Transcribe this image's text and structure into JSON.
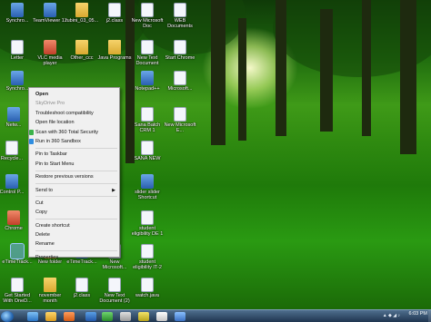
{
  "desktop": {
    "icons": {
      "synchro1": "Synchro...",
      "teamviewer": "TeamViewer 12",
      "rubini": "rubini_03_05...",
      "j2": "j2.class",
      "newdoc1": "New Microsoft Doc",
      "web": "WEB Documents",
      "letter": "Letter",
      "vlc": "VLC media player",
      "other": "Other_ccc",
      "javaprog": "Java Programs",
      "newtext": "New Text Document",
      "chrome": "Start Chrome",
      "synchro2": "Synchro...",
      "notepad": "Notepad++",
      "microsoft1": "Microsoft...",
      "netw": "Netw...",
      "sana": "Sana Batch CRM 1",
      "newexcel": "New Microsoft E...",
      "recycle": "Recycle...",
      "sananew": "SANA NEW",
      "control": "Control P...",
      "slider": "slider slider Shortcut",
      "chrome2": "Chrome",
      "student1": "student eligibility DE 1",
      "student2": "student eligibility IT-2",
      "selected": "eTimeTrack...",
      "newfolder": "New folder",
      "etimetrack": "eTimeTrack...",
      "newms": "New Microsoft...",
      "getstarted": "Get Started With OneD...",
      "november": "november month",
      "j2class": "j2.class",
      "newtext2": "New Text Document (2)",
      "watchjava": "watch.java"
    }
  },
  "context_menu": {
    "open": "Open",
    "skydrive": "SkyDrive Pro",
    "troubleshoot": "Troubleshoot compatibility",
    "open_file_location": "Open file location",
    "scan_360": "Scan with 360 Total Security",
    "run_sandbox": "Run in 360 Sandbox",
    "pin_taskbar": "Pin to Taskbar",
    "pin_start": "Pin to Start Menu",
    "restore": "Restore previous versions",
    "send_to": "Send to",
    "cut": "Cut",
    "copy": "Copy",
    "create_shortcut": "Create shortcut",
    "delete": "Delete",
    "rename": "Rename",
    "properties": "Properties"
  },
  "taskbar": {
    "clock_time": "6:03 PM"
  },
  "colors": {
    "menu_bg": "#f0f0f0",
    "taskbar": "#2a4566",
    "accent": "#2a6bb5"
  }
}
